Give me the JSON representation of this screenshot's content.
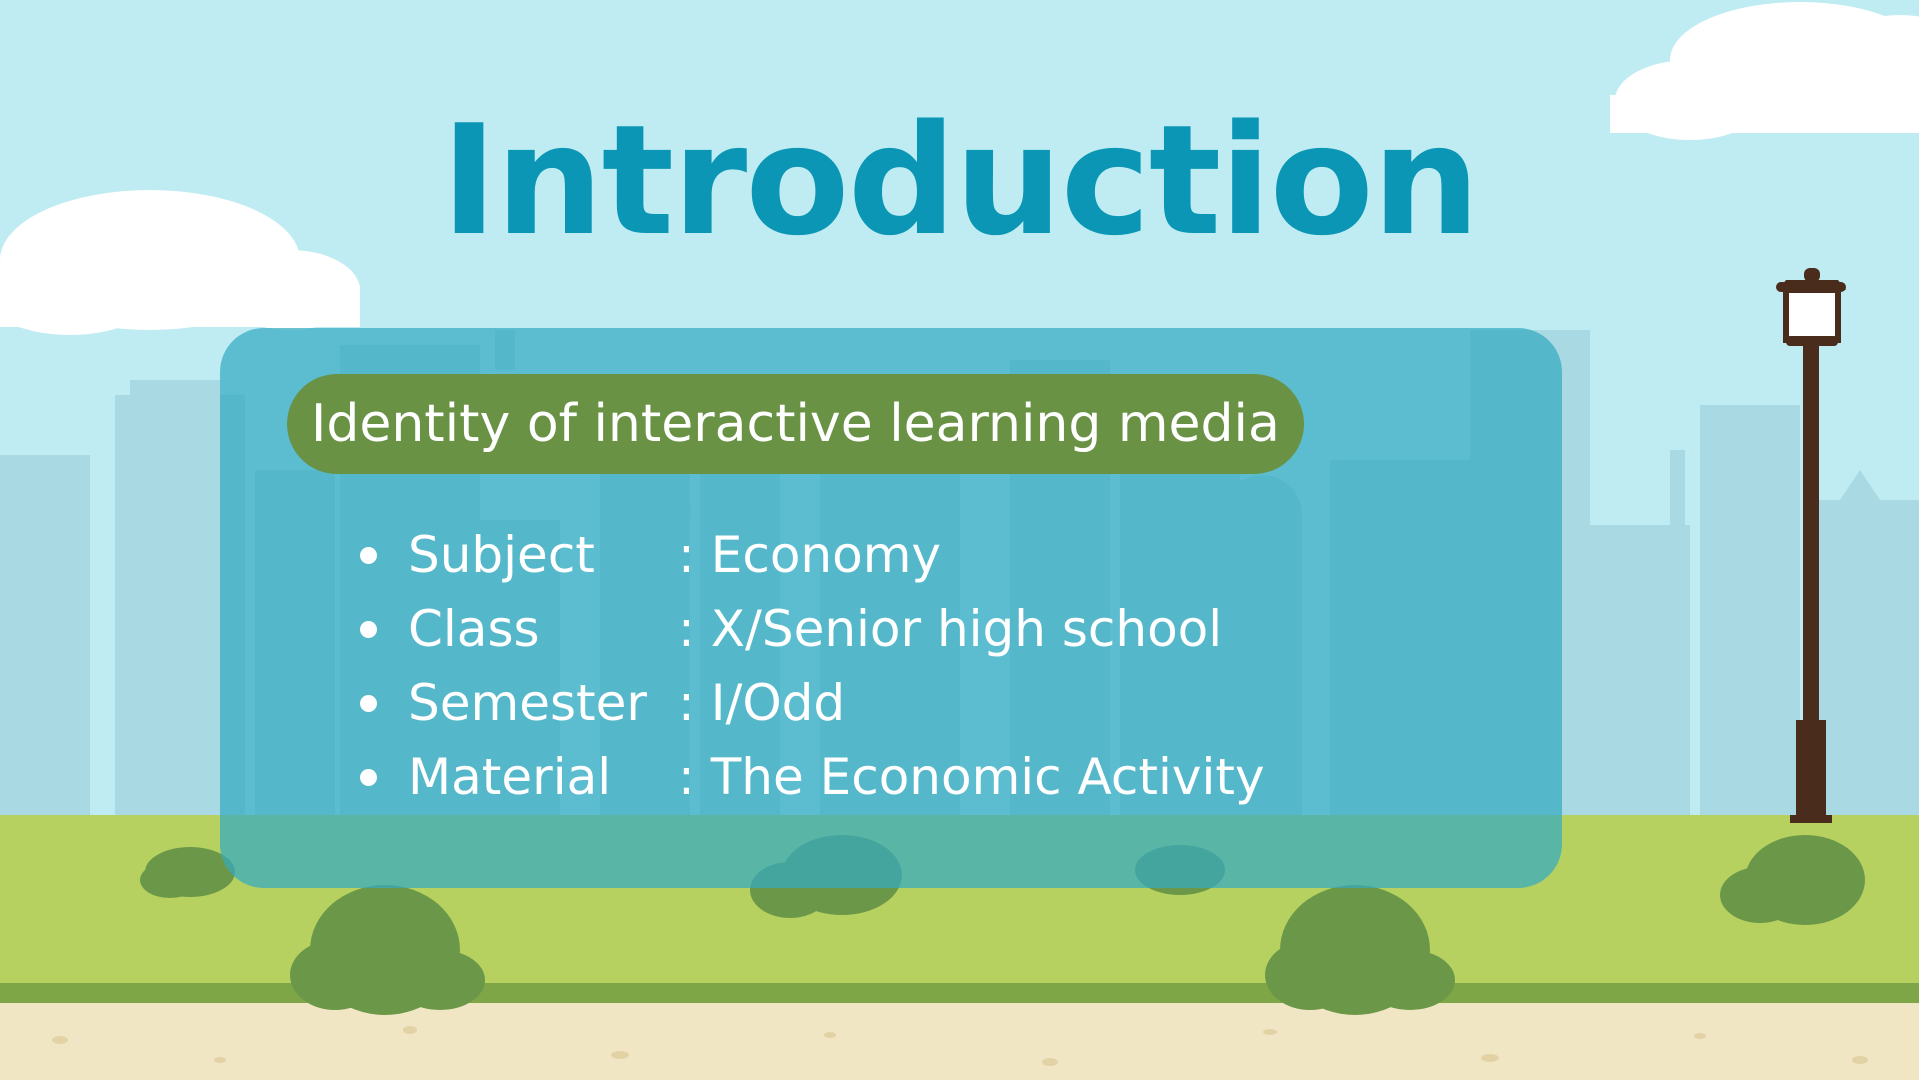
{
  "slide": {
    "title": "Introduction",
    "section_label": "Identity of interactive learning media",
    "items": [
      {
        "label": "Subject",
        "value": ": Economy"
      },
      {
        "label": "Class",
        "value": ": X/Senior high school"
      },
      {
        "label": "Semester",
        "value": ": I/Odd"
      },
      {
        "label": "Material",
        "value": ": The Economic Activity"
      }
    ]
  },
  "colors": {
    "sky": "#bfecf2",
    "title": "#0a96b4",
    "panel": "#34aac0",
    "pill": "#6a9244",
    "grass": "#b7d160",
    "bush": "#6b9848",
    "path": "#f1e6c4",
    "lamp": "#4a2c1c"
  },
  "icons": [
    "cloud-icon",
    "lamp-post-icon",
    "bush-icon",
    "city-skyline-icon"
  ]
}
